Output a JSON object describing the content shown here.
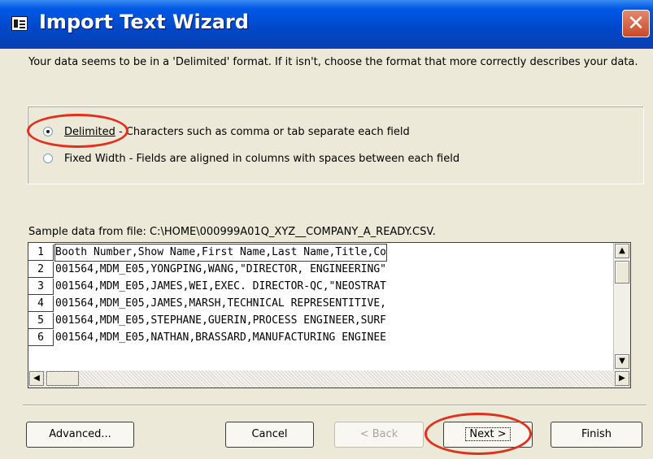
{
  "window": {
    "title": "Import Text Wizard",
    "close_glyph": "✕"
  },
  "intro_text": "Your data seems to be in a 'Delimited' format. If it isn't, choose the format that more correctly describes your data.",
  "format_options": [
    {
      "label": "Delimited",
      "description": "- Characters such as comma or tab separate each field",
      "selected": true
    },
    {
      "label": "Fixed Width",
      "description": "- Fields are aligned in columns with spaces between each field",
      "selected": false
    }
  ],
  "sample": {
    "label": "Sample data from file: C:\\HOME\\000999A01Q_XYZ__COMPANY_A_READY.CSV.",
    "rows": [
      {
        "num": "1",
        "text": "Booth Number,Show Name,First Name,Last Name,Title,Co"
      },
      {
        "num": "2",
        "text": "001564,MDM_E05,YONGPING,WANG,\"DIRECTOR, ENGINEERING\""
      },
      {
        "num": "3",
        "text": "001564,MDM_E05,JAMES,WEI,EXEC. DIRECTOR-QC,\"NEOSTRAT"
      },
      {
        "num": "4",
        "text": "001564,MDM_E05,JAMES,MARSH,TECHNICAL REPRESENTITIVE,"
      },
      {
        "num": "5",
        "text": "001564,MDM_E05,STEPHANE,GUERIN,PROCESS ENGINEER,SURF"
      },
      {
        "num": "6",
        "text": "001564,MDM_E05,NATHAN,BRASSARD,MANUFACTURING ENGINEE"
      }
    ]
  },
  "buttons": {
    "advanced": "Advanced...",
    "cancel": "Cancel",
    "back": "< Back",
    "next": "Next >",
    "finish": "Finish"
  },
  "colors": {
    "title_bar": "#0047c8",
    "highlight_ring": "#e0301e"
  }
}
